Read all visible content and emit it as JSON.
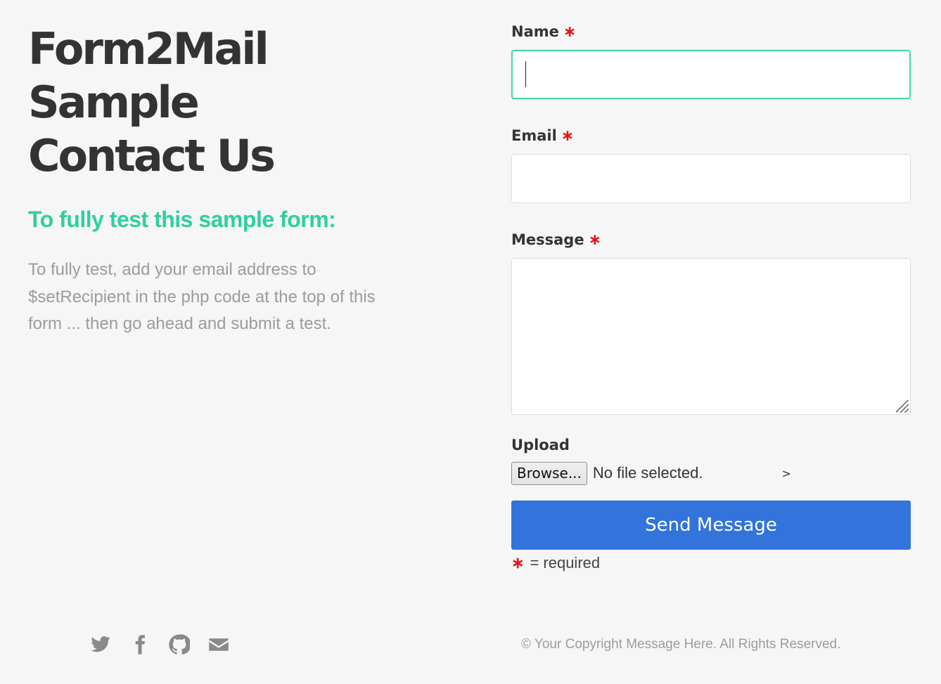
{
  "hero": {
    "title_lines": [
      "Form2Mail",
      "Sample",
      "Contact Us"
    ],
    "subtitle": "To fully test this sample form:",
    "description": "To fully test, add your email address to $setRecipient in the php code at the top of this form ... then go ahead and submit a test."
  },
  "form": {
    "name_label": "Name",
    "email_label": "Email",
    "message_label": "Message",
    "required_mark": "∗",
    "name_value": "",
    "email_value": "",
    "message_value": "",
    "upload_label": "Upload",
    "browse_label": "Browse...",
    "no_file_text": "No file selected.",
    "stray_text": ">",
    "submit_label": "Send Message",
    "required_note": "= required"
  },
  "footer": {
    "social_icons": [
      "twitter-icon",
      "facebook-icon",
      "github-icon",
      "envelope-icon"
    ],
    "copyright": "© Your Copyright Message Here. All Rights Reserved."
  },
  "colors": {
    "accent_green": "#2fcf9f",
    "button_blue": "#3274dc",
    "required_red": "#e8141a",
    "background": "#f6f6f6"
  }
}
